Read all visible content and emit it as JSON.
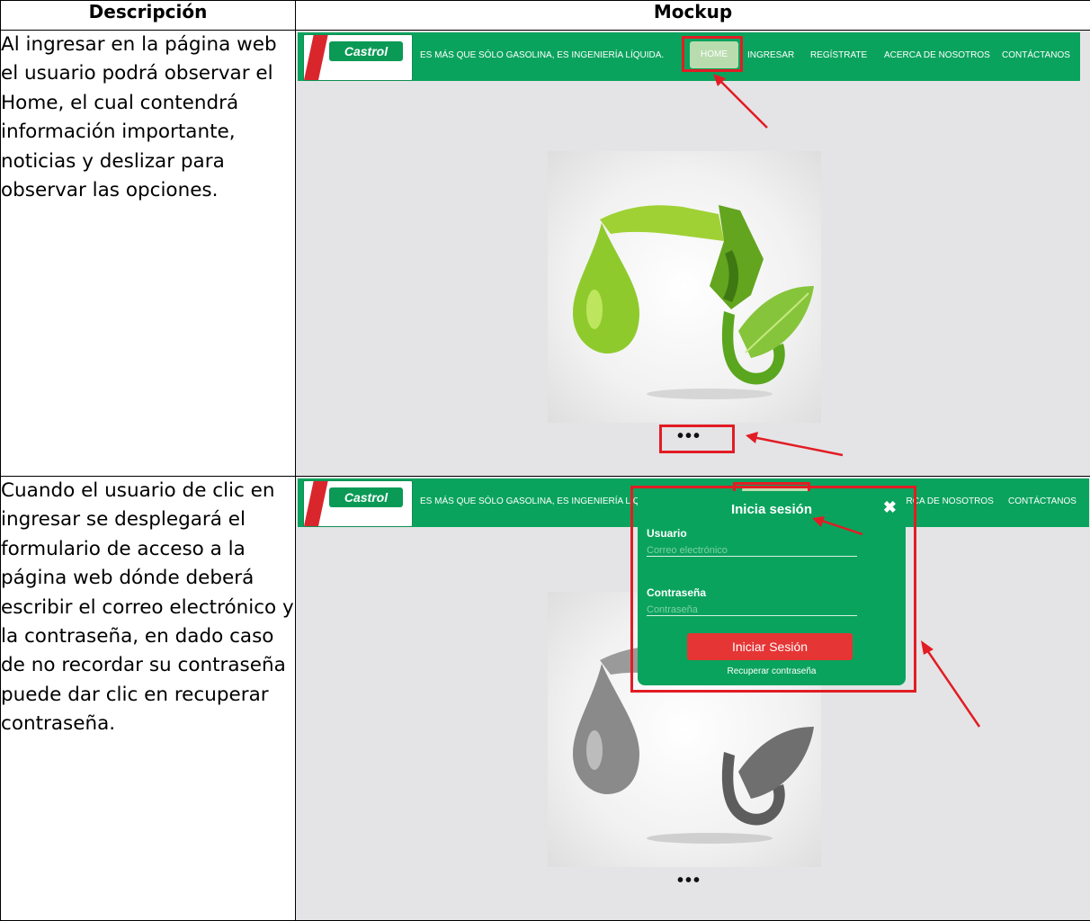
{
  "headers": {
    "description": "Descripción",
    "mockup": "Mockup"
  },
  "rows": [
    {
      "description": "Al ingresar en la página web el usuario podrá observar el Home, el cual contendrá información importante, noticias y deslizar para observar las opciones."
    },
    {
      "description": "Cuando el usuario de clic en ingresar se desplegará el formulario de acceso a la página web dónde deberá escribir el correo electrónico y la contraseña, en dado caso de no recordar su contraseña puede dar clic en recuperar contraseña."
    }
  ],
  "site": {
    "logo_text": "Castrol",
    "tagline": "ES MÁS QUE SÓLO GASOLINA, ES INGENIERÍA LÍQUIDA.",
    "nav": [
      "HOME",
      "INGRESAR",
      "REGÍSTRATE",
      "ACERCA DE NOSOTROS",
      "CONTÁCTANOS"
    ],
    "carousel_dots": "•••"
  },
  "login": {
    "title": "Inicia sesión",
    "close": "✖",
    "user_label": "Usuario",
    "user_placeholder": "Correo electrónico",
    "password_label": "Contraseña",
    "password_placeholder": "Contraseña",
    "submit": "Iniciar Sesión",
    "recover": "Recuperar contraseña"
  },
  "colors": {
    "brand_green": "#0aa35d",
    "accent_red": "#e21c24",
    "button_red": "#e53535",
    "active_tab": "#b9dcae"
  },
  "icons": [
    "castrol-logo",
    "fuel-nozzle-drop-leaf-image",
    "close-icon",
    "red-annotation-arrow"
  ]
}
